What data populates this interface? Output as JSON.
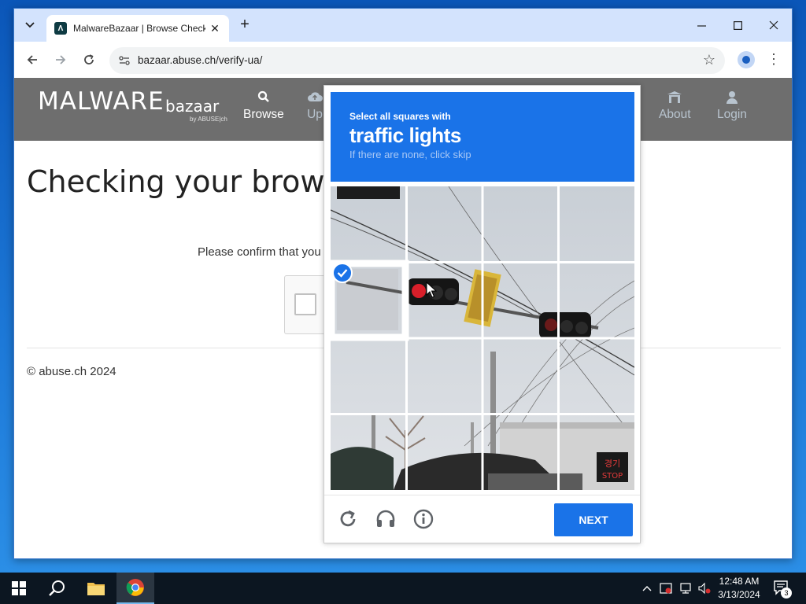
{
  "browser": {
    "tab_title": "MalwareBazaar | Browse Checking",
    "tab_close": "✕",
    "new_tab": "+",
    "url": "bazaar.abuse.ch/verify-ua/",
    "window_controls": {
      "minimize": "—",
      "maximize": "☐",
      "close": "✕"
    }
  },
  "site": {
    "logo_main": "MALWARE",
    "logo_sub": "bazaar",
    "logo_by": "by ABUSE|ch",
    "nav": [
      {
        "label": "Browse",
        "icon": "search-icon"
      },
      {
        "label": "Up",
        "icon": "upload-icon"
      },
      {
        "label": "About",
        "icon": "about-icon"
      },
      {
        "label": "Login",
        "icon": "user-icon"
      }
    ]
  },
  "page": {
    "title": "Checking your brows",
    "confirm_text": "Please confirm that you",
    "footer": "© abuse.ch 2024"
  },
  "captcha": {
    "instruction": "Select all squares with",
    "object": "traffic lights",
    "hint": "If there are none, click skip",
    "selected_tiles": [
      4
    ],
    "next_label": "NEXT",
    "footer_icons": [
      "reload-icon",
      "audio-icon",
      "info-icon"
    ],
    "sign_text": [
      "경기",
      "STOP"
    ]
  },
  "taskbar": {
    "time": "12:48 AM",
    "date": "3/13/2024",
    "notification_count": "3"
  }
}
